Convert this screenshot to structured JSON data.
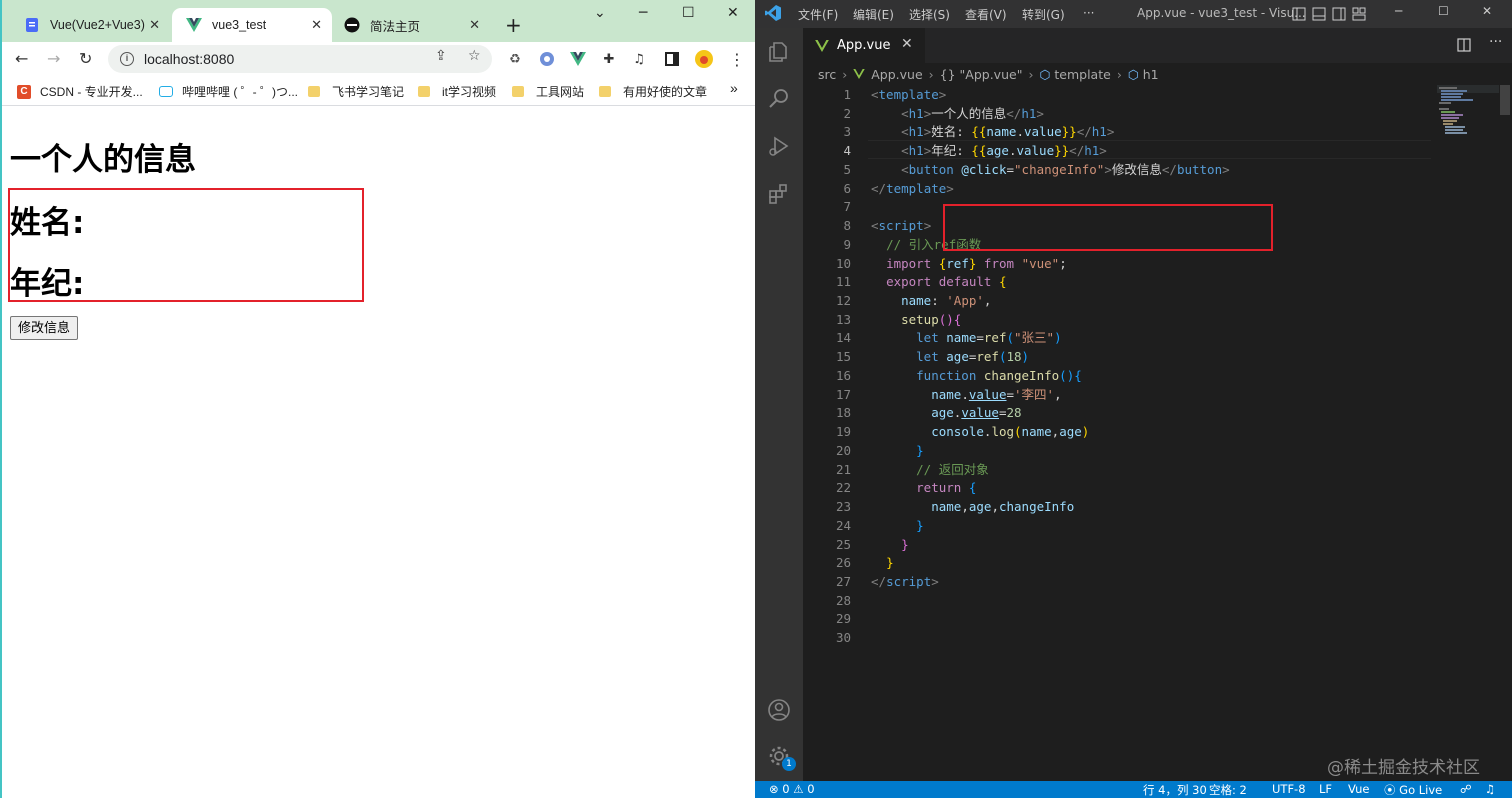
{
  "browser": {
    "tabs": [
      {
        "label": "Vue(Vue2+Vue3)",
        "icon": "doc-icon"
      },
      {
        "label": "vue3_test",
        "icon": "vue-icon"
      },
      {
        "label": "简法主页",
        "icon": "jianfa-icon"
      }
    ],
    "url": "localhost:8080",
    "bookmarks": [
      {
        "label": "CSDN - 专业开发...",
        "icon": "csdn-icon"
      },
      {
        "label": "哔哩哔哩 ( ゜- ゜)つ...",
        "icon": "bilibili-icon"
      },
      {
        "label": "飞书学习笔记",
        "icon": "folder-icon"
      },
      {
        "label": "it学习视频",
        "icon": "folder-icon"
      },
      {
        "label": "工具网站",
        "icon": "folder-icon"
      },
      {
        "label": "有用好使的文章",
        "icon": "folder-icon"
      }
    ],
    "bookmarks_more": "»",
    "page": {
      "heading": "一个人的信息",
      "name_label": "姓名:",
      "age_label": "年纪:",
      "button_label": "修改信息"
    }
  },
  "vscode": {
    "menu": [
      "文件(F)",
      "编辑(E)",
      "选择(S)",
      "查看(V)",
      "转到(G)",
      "···"
    ],
    "window_title": "App.vue - vue3_test - Visu...",
    "tab_label": "App.vue",
    "breadcrumbs": [
      "src",
      "App.vue",
      "{} \"App.vue\"",
      "template",
      "h1"
    ],
    "current_line": 4,
    "line_count": 30,
    "watermark": "@稀土掘金技术社区",
    "status": {
      "errors": "0",
      "warnings": "0",
      "position": "行 4，列 30",
      "spaces": "空格: 2",
      "encoding": "UTF-8",
      "eol": "LF",
      "language": "Vue",
      "golive": "Go Live"
    },
    "badge_count": "1"
  },
  "colors": {
    "highlight_box": "#e3212b",
    "statusbar": "#007acc",
    "tabstrip": "#c9e6cd"
  }
}
